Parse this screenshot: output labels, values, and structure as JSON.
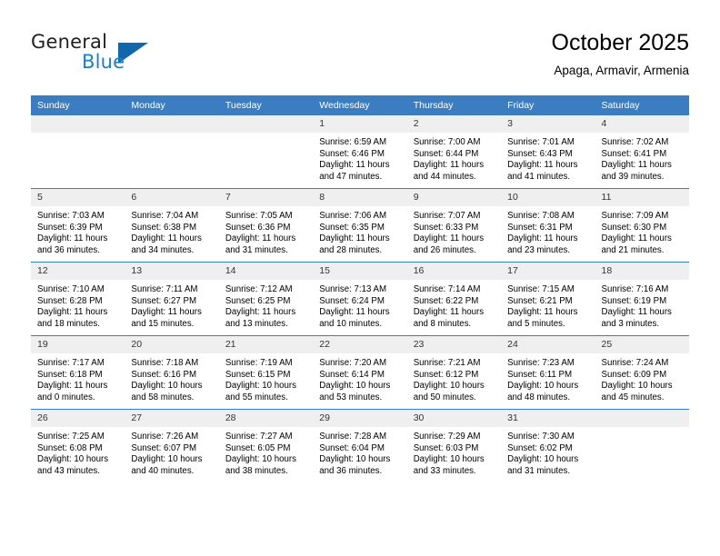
{
  "brand": {
    "name_part1": "General",
    "name_part2": "Blue",
    "accent_color": "#1c7fc4",
    "triangle_color": "#1266ab"
  },
  "header": {
    "title": "October 2025",
    "subtitle": "Apaga, Armavir, Armenia"
  },
  "theme": {
    "header_bar_color": "#3b7dc0",
    "daynum_band_color": "#efefef",
    "row_divider_color": "#3b7dc0"
  },
  "weekday_headers": [
    "Sunday",
    "Monday",
    "Tuesday",
    "Wednesday",
    "Thursday",
    "Friday",
    "Saturday"
  ],
  "weeks": [
    [
      {
        "day": "",
        "sunrise": "",
        "sunset": "",
        "daylight": ""
      },
      {
        "day": "",
        "sunrise": "",
        "sunset": "",
        "daylight": ""
      },
      {
        "day": "",
        "sunrise": "",
        "sunset": "",
        "daylight": ""
      },
      {
        "day": "1",
        "sunrise": "Sunrise: 6:59 AM",
        "sunset": "Sunset: 6:46 PM",
        "daylight": "Daylight: 11 hours and 47 minutes."
      },
      {
        "day": "2",
        "sunrise": "Sunrise: 7:00 AM",
        "sunset": "Sunset: 6:44 PM",
        "daylight": "Daylight: 11 hours and 44 minutes."
      },
      {
        "day": "3",
        "sunrise": "Sunrise: 7:01 AM",
        "sunset": "Sunset: 6:43 PM",
        "daylight": "Daylight: 11 hours and 41 minutes."
      },
      {
        "day": "4",
        "sunrise": "Sunrise: 7:02 AM",
        "sunset": "Sunset: 6:41 PM",
        "daylight": "Daylight: 11 hours and 39 minutes."
      }
    ],
    [
      {
        "day": "5",
        "sunrise": "Sunrise: 7:03 AM",
        "sunset": "Sunset: 6:39 PM",
        "daylight": "Daylight: 11 hours and 36 minutes."
      },
      {
        "day": "6",
        "sunrise": "Sunrise: 7:04 AM",
        "sunset": "Sunset: 6:38 PM",
        "daylight": "Daylight: 11 hours and 34 minutes."
      },
      {
        "day": "7",
        "sunrise": "Sunrise: 7:05 AM",
        "sunset": "Sunset: 6:36 PM",
        "daylight": "Daylight: 11 hours and 31 minutes."
      },
      {
        "day": "8",
        "sunrise": "Sunrise: 7:06 AM",
        "sunset": "Sunset: 6:35 PM",
        "daylight": "Daylight: 11 hours and 28 minutes."
      },
      {
        "day": "9",
        "sunrise": "Sunrise: 7:07 AM",
        "sunset": "Sunset: 6:33 PM",
        "daylight": "Daylight: 11 hours and 26 minutes."
      },
      {
        "day": "10",
        "sunrise": "Sunrise: 7:08 AM",
        "sunset": "Sunset: 6:31 PM",
        "daylight": "Daylight: 11 hours and 23 minutes."
      },
      {
        "day": "11",
        "sunrise": "Sunrise: 7:09 AM",
        "sunset": "Sunset: 6:30 PM",
        "daylight": "Daylight: 11 hours and 21 minutes."
      }
    ],
    [
      {
        "day": "12",
        "sunrise": "Sunrise: 7:10 AM",
        "sunset": "Sunset: 6:28 PM",
        "daylight": "Daylight: 11 hours and 18 minutes."
      },
      {
        "day": "13",
        "sunrise": "Sunrise: 7:11 AM",
        "sunset": "Sunset: 6:27 PM",
        "daylight": "Daylight: 11 hours and 15 minutes."
      },
      {
        "day": "14",
        "sunrise": "Sunrise: 7:12 AM",
        "sunset": "Sunset: 6:25 PM",
        "daylight": "Daylight: 11 hours and 13 minutes."
      },
      {
        "day": "15",
        "sunrise": "Sunrise: 7:13 AM",
        "sunset": "Sunset: 6:24 PM",
        "daylight": "Daylight: 11 hours and 10 minutes."
      },
      {
        "day": "16",
        "sunrise": "Sunrise: 7:14 AM",
        "sunset": "Sunset: 6:22 PM",
        "daylight": "Daylight: 11 hours and 8 minutes."
      },
      {
        "day": "17",
        "sunrise": "Sunrise: 7:15 AM",
        "sunset": "Sunset: 6:21 PM",
        "daylight": "Daylight: 11 hours and 5 minutes."
      },
      {
        "day": "18",
        "sunrise": "Sunrise: 7:16 AM",
        "sunset": "Sunset: 6:19 PM",
        "daylight": "Daylight: 11 hours and 3 minutes."
      }
    ],
    [
      {
        "day": "19",
        "sunrise": "Sunrise: 7:17 AM",
        "sunset": "Sunset: 6:18 PM",
        "daylight": "Daylight: 11 hours and 0 minutes."
      },
      {
        "day": "20",
        "sunrise": "Sunrise: 7:18 AM",
        "sunset": "Sunset: 6:16 PM",
        "daylight": "Daylight: 10 hours and 58 minutes."
      },
      {
        "day": "21",
        "sunrise": "Sunrise: 7:19 AM",
        "sunset": "Sunset: 6:15 PM",
        "daylight": "Daylight: 10 hours and 55 minutes."
      },
      {
        "day": "22",
        "sunrise": "Sunrise: 7:20 AM",
        "sunset": "Sunset: 6:14 PM",
        "daylight": "Daylight: 10 hours and 53 minutes."
      },
      {
        "day": "23",
        "sunrise": "Sunrise: 7:21 AM",
        "sunset": "Sunset: 6:12 PM",
        "daylight": "Daylight: 10 hours and 50 minutes."
      },
      {
        "day": "24",
        "sunrise": "Sunrise: 7:23 AM",
        "sunset": "Sunset: 6:11 PM",
        "daylight": "Daylight: 10 hours and 48 minutes."
      },
      {
        "day": "25",
        "sunrise": "Sunrise: 7:24 AM",
        "sunset": "Sunset: 6:09 PM",
        "daylight": "Daylight: 10 hours and 45 minutes."
      }
    ],
    [
      {
        "day": "26",
        "sunrise": "Sunrise: 7:25 AM",
        "sunset": "Sunset: 6:08 PM",
        "daylight": "Daylight: 10 hours and 43 minutes."
      },
      {
        "day": "27",
        "sunrise": "Sunrise: 7:26 AM",
        "sunset": "Sunset: 6:07 PM",
        "daylight": "Daylight: 10 hours and 40 minutes."
      },
      {
        "day": "28",
        "sunrise": "Sunrise: 7:27 AM",
        "sunset": "Sunset: 6:05 PM",
        "daylight": "Daylight: 10 hours and 38 minutes."
      },
      {
        "day": "29",
        "sunrise": "Sunrise: 7:28 AM",
        "sunset": "Sunset: 6:04 PM",
        "daylight": "Daylight: 10 hours and 36 minutes."
      },
      {
        "day": "30",
        "sunrise": "Sunrise: 7:29 AM",
        "sunset": "Sunset: 6:03 PM",
        "daylight": "Daylight: 10 hours and 33 minutes."
      },
      {
        "day": "31",
        "sunrise": "Sunrise: 7:30 AM",
        "sunset": "Sunset: 6:02 PM",
        "daylight": "Daylight: 10 hours and 31 minutes."
      },
      {
        "day": "",
        "sunrise": "",
        "sunset": "",
        "daylight": ""
      }
    ]
  ]
}
